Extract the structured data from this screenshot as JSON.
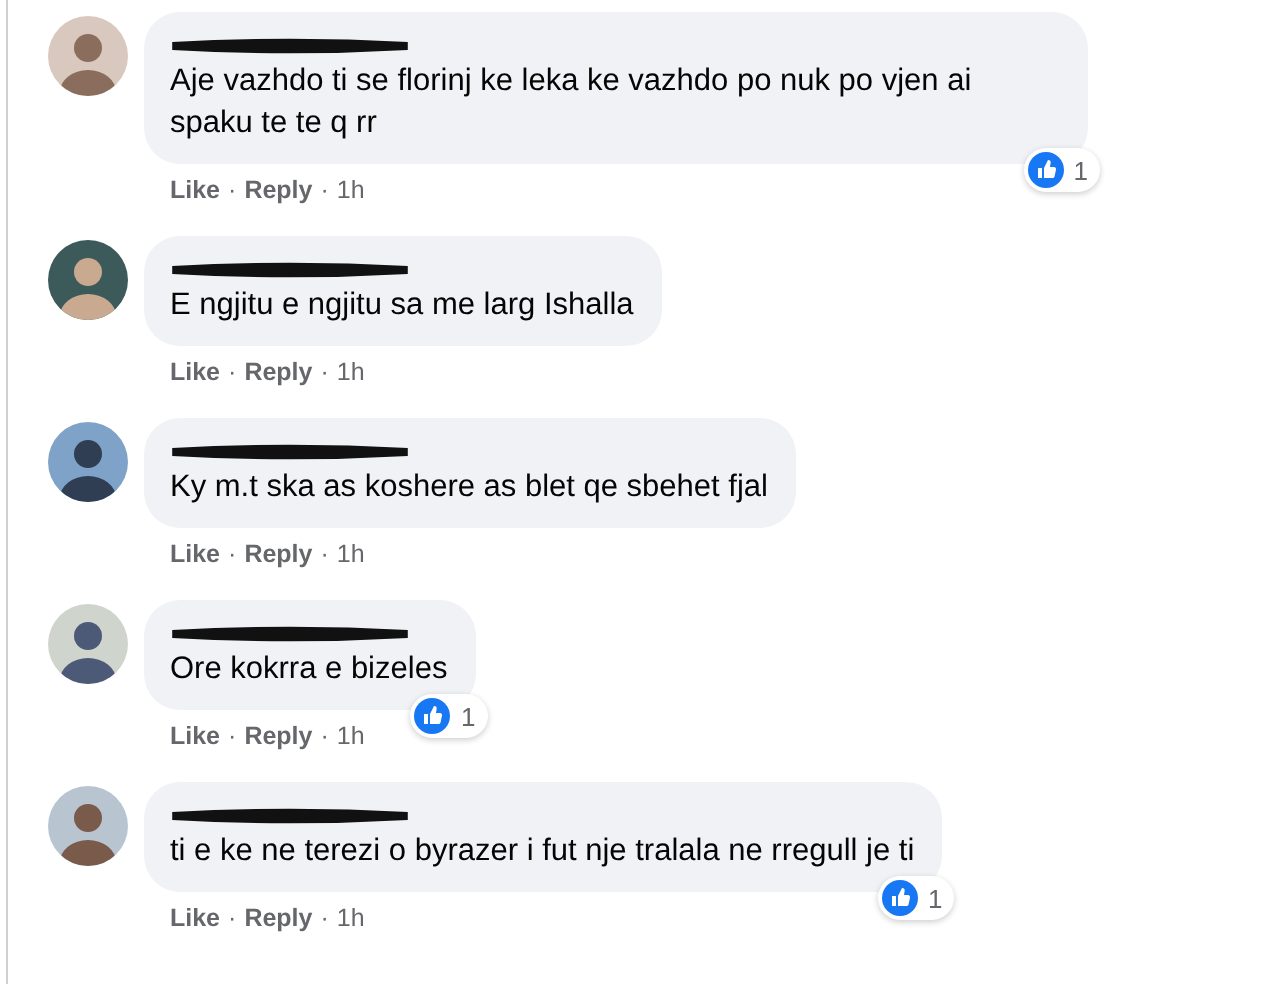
{
  "separator": "·",
  "comments": [
    {
      "name_redacted": true,
      "text": "Aje vazhdo ti se florinj ke leka ke vazhdo po nuk po vjen ai spaku te te q rr",
      "reactions": "1",
      "actions": {
        "like": "Like",
        "reply": "Reply",
        "time": "1h"
      }
    },
    {
      "name_redacted": true,
      "text": "E ngjitu e ngjitu sa me larg Ishalla",
      "actions": {
        "like": "Like",
        "reply": "Reply",
        "time": "1h"
      }
    },
    {
      "name_redacted": true,
      "text": "Ky m.t ska as koshere as blet qe sbehet fjal",
      "actions": {
        "like": "Like",
        "reply": "Reply",
        "time": "1h"
      }
    },
    {
      "name_redacted": true,
      "text": "Ore kokrra e bizeles",
      "reactions": "1",
      "actions": {
        "like": "Like",
        "reply": "Reply",
        "time": "1h"
      }
    },
    {
      "name_redacted": true,
      "text": "ti e ke ne terezi o byrazer i fut nje tralala ne rregull je ti",
      "reactions": "1",
      "actions": {
        "like": "Like",
        "reply": "Reply",
        "time": "1h"
      }
    }
  ]
}
